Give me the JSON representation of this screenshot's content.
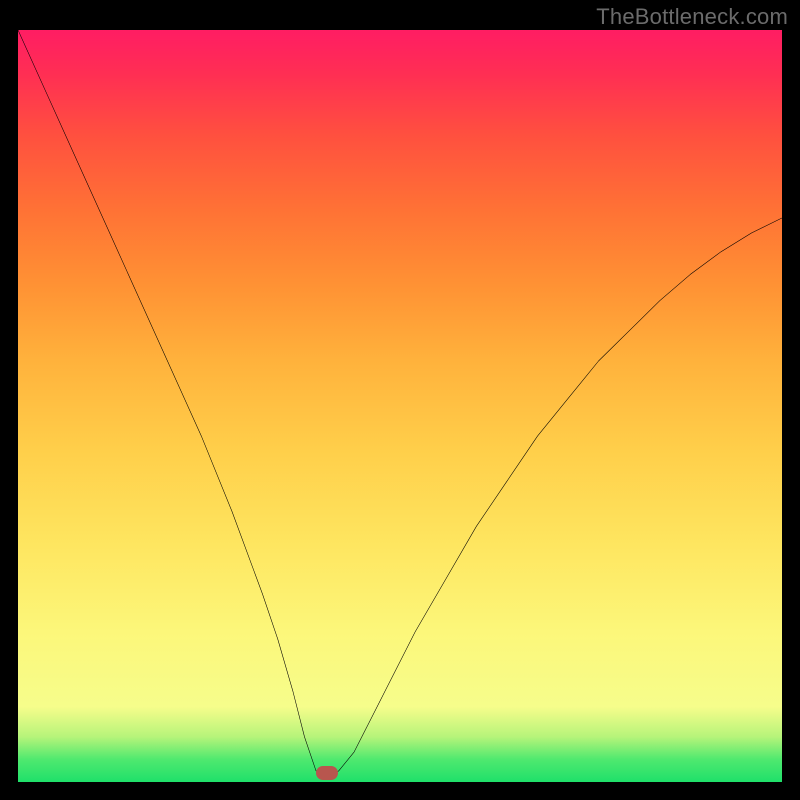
{
  "watermark": "TheBottleneck.com",
  "chart_data": {
    "type": "line",
    "title": "",
    "xlabel": "",
    "ylabel": "",
    "xlim": [
      0,
      100
    ],
    "ylim": [
      0,
      100
    ],
    "series": [
      {
        "name": "curve",
        "x": [
          0,
          4,
          8,
          12,
          16,
          20,
          24,
          28,
          32,
          34,
          36,
          37.5,
          39,
          40,
          41,
          42,
          44,
          48,
          52,
          56,
          60,
          64,
          68,
          72,
          76,
          80,
          84,
          88,
          92,
          96,
          100
        ],
        "y": [
          100,
          91,
          82,
          73,
          64,
          55,
          46,
          36,
          25,
          19,
          12,
          6,
          1.5,
          0.8,
          0.8,
          1.5,
          4,
          12,
          20,
          27,
          34,
          40,
          46,
          51,
          56,
          60,
          64,
          67.5,
          70.5,
          73,
          75
        ]
      }
    ],
    "marker": {
      "name": "bottleneck-point",
      "x": 40.5,
      "y": 1.2
    },
    "gradient_stops": [
      {
        "pos": 0,
        "color": "#1fe06a"
      },
      {
        "pos": 10,
        "color": "#f6fd8b"
      },
      {
        "pos": 50,
        "color": "#ffb23c"
      },
      {
        "pos": 100,
        "color": "#ff1d63"
      }
    ]
  }
}
